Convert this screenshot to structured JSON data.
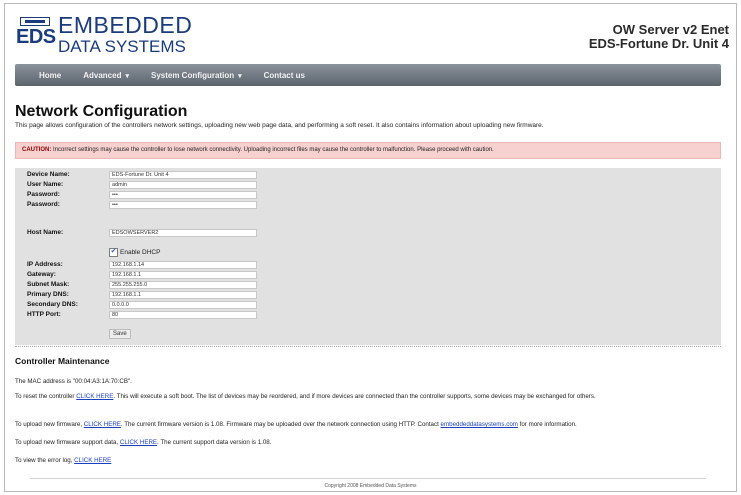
{
  "header": {
    "logo_mark": "EDS",
    "logo_line1": "EMBEDDED",
    "logo_line2": "DATA SYSTEMS",
    "device_line1": "OW Server v2 Enet",
    "device_line2": "EDS-Fortune Dr. Unit 4"
  },
  "nav": {
    "items": [
      {
        "label": "Home",
        "dropdown": false
      },
      {
        "label": "Advanced",
        "dropdown": true
      },
      {
        "label": "System Configuration",
        "dropdown": true
      },
      {
        "label": "Contact us",
        "dropdown": false
      }
    ]
  },
  "page": {
    "title": "Network Configuration",
    "description": "This page allows configuration of the controllers network settings, uploading new web page data, and performing a soft reset. It also contains information about uploading new firmware.",
    "caution_label": "CAUTION:",
    "caution_text": " Incorrect settings may cause the controller to lose network connectivity. Uploading incorrect files may cause the controller to malfunction. Please proceed with caution."
  },
  "form": {
    "device_name_label": "Device Name:",
    "device_name_value": "EDS-Fortune Dr. Unit 4",
    "user_name_label": "User Name:",
    "user_name_value": "admin",
    "password_label": "Password:",
    "password_value": "•••",
    "password2_label": "Password:",
    "password2_value": "•••",
    "host_name_label": "Host Name:",
    "host_name_value": "EDSOWSERVER2",
    "dhcp_label": "Enable DHCP",
    "dhcp_checked": "✔",
    "ip_label": "IP Address:",
    "ip_value": "192.168.1.14",
    "gateway_label": "Gateway:",
    "gateway_value": "192.168.1.1",
    "subnet_label": "Subnet Mask:",
    "subnet_value": "255.255.255.0",
    "dns1_label": "Primary DNS:",
    "dns1_value": "192.168.1.1",
    "dns2_label": "Secondary DNS:",
    "dns2_value": "0.0.0.0",
    "http_label": "HTTP Port:",
    "http_value": "80",
    "save_label": "Save"
  },
  "maintenance": {
    "title": "Controller Maintenance",
    "mac_text": "The MAC address is \"00:04:A3:1A:70:CB\".",
    "reset_pre": "To reset the controller ",
    "reset_link": "CLICK HERE",
    "reset_post": ". This will execute a soft boot. The list of devices may be reordered, and if more devices are connected than the controller supports, some devices may be exchanged for others.",
    "firmware_pre": "To upload new firmware, ",
    "firmware_link": "CLICK HERE",
    "firmware_mid": ". The current firmware version is 1.08. Firmware may be uploaded over the network connection using HTTP. Contact ",
    "firmware_contact": "embeddeddatasystems.com",
    "firmware_post": " for more information.",
    "support_pre": "To upload new firmware support data, ",
    "support_link": "CLICK HERE",
    "support_post": ". The current support data version is 1.08.",
    "errorlog_pre": "To view the error log, ",
    "errorlog_link": "CLICK HERE"
  },
  "footer": {
    "copyright": "Copyright 2008 Embedded Data Systems"
  }
}
